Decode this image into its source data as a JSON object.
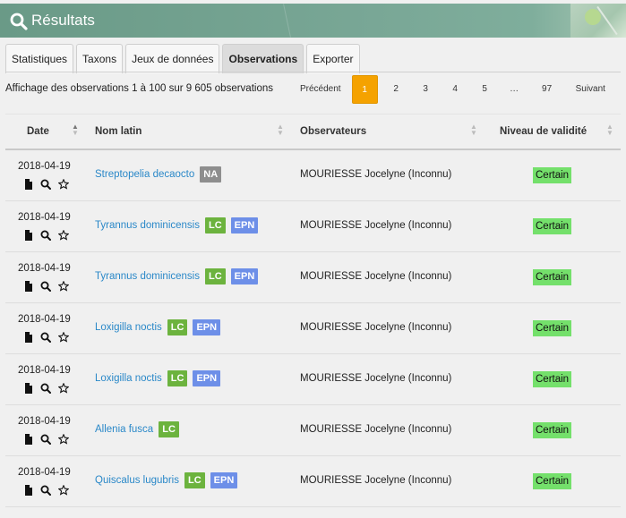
{
  "header": {
    "title": "Résultats"
  },
  "tabs": [
    {
      "label": "Statistiques",
      "active": false
    },
    {
      "label": "Taxons",
      "active": false
    },
    {
      "label": "Jeux de données",
      "active": false
    },
    {
      "label": "Observations",
      "active": true
    },
    {
      "label": "Exporter",
      "active": false
    }
  ],
  "summary": "Affichage des observations 1 à 100 sur 9 605 observations",
  "pagination": {
    "prev": "Précédent",
    "pages": [
      "1",
      "2",
      "3",
      "4",
      "5",
      "…",
      "97"
    ],
    "current": "1",
    "next": "Suivant"
  },
  "columns": {
    "date": "Date",
    "nom_latin": "Nom latin",
    "observateurs": "Observateurs",
    "niveau": "Niveau de validité"
  },
  "colors": {
    "accent": "#f5a200",
    "link": "#2a88c8",
    "badge_NA": "#8e8e8e",
    "badge_LC": "#6cb33e",
    "badge_EPN": "#6d8fe8",
    "valid": "#74e06b"
  },
  "icons": [
    "search-icon",
    "document-icon",
    "magnifier-icon",
    "star-icon"
  ],
  "rows": [
    {
      "date": "2018-04-19",
      "latin": "Streptopelia decaocto",
      "badges": [
        "NA"
      ],
      "observer": "MOURIESSE Jocelyne (Inconnu)",
      "validity": "Certain"
    },
    {
      "date": "2018-04-19",
      "latin": "Tyrannus dominicensis",
      "badges": [
        "LC",
        "EPN"
      ],
      "observer": "MOURIESSE Jocelyne (Inconnu)",
      "validity": "Certain"
    },
    {
      "date": "2018-04-19",
      "latin": "Tyrannus dominicensis",
      "badges": [
        "LC",
        "EPN"
      ],
      "observer": "MOURIESSE Jocelyne (Inconnu)",
      "validity": "Certain"
    },
    {
      "date": "2018-04-19",
      "latin": "Loxigilla noctis",
      "badges": [
        "LC",
        "EPN"
      ],
      "observer": "MOURIESSE Jocelyne (Inconnu)",
      "validity": "Certain"
    },
    {
      "date": "2018-04-19",
      "latin": "Loxigilla noctis",
      "badges": [
        "LC",
        "EPN"
      ],
      "observer": "MOURIESSE Jocelyne (Inconnu)",
      "validity": "Certain"
    },
    {
      "date": "2018-04-19",
      "latin": "Allenia fusca",
      "badges": [
        "LC"
      ],
      "observer": "MOURIESSE Jocelyne (Inconnu)",
      "validity": "Certain"
    },
    {
      "date": "2018-04-19",
      "latin": "Quiscalus lugubris",
      "badges": [
        "LC",
        "EPN"
      ],
      "observer": "MOURIESSE Jocelyne (Inconnu)",
      "validity": "Certain"
    }
  ]
}
